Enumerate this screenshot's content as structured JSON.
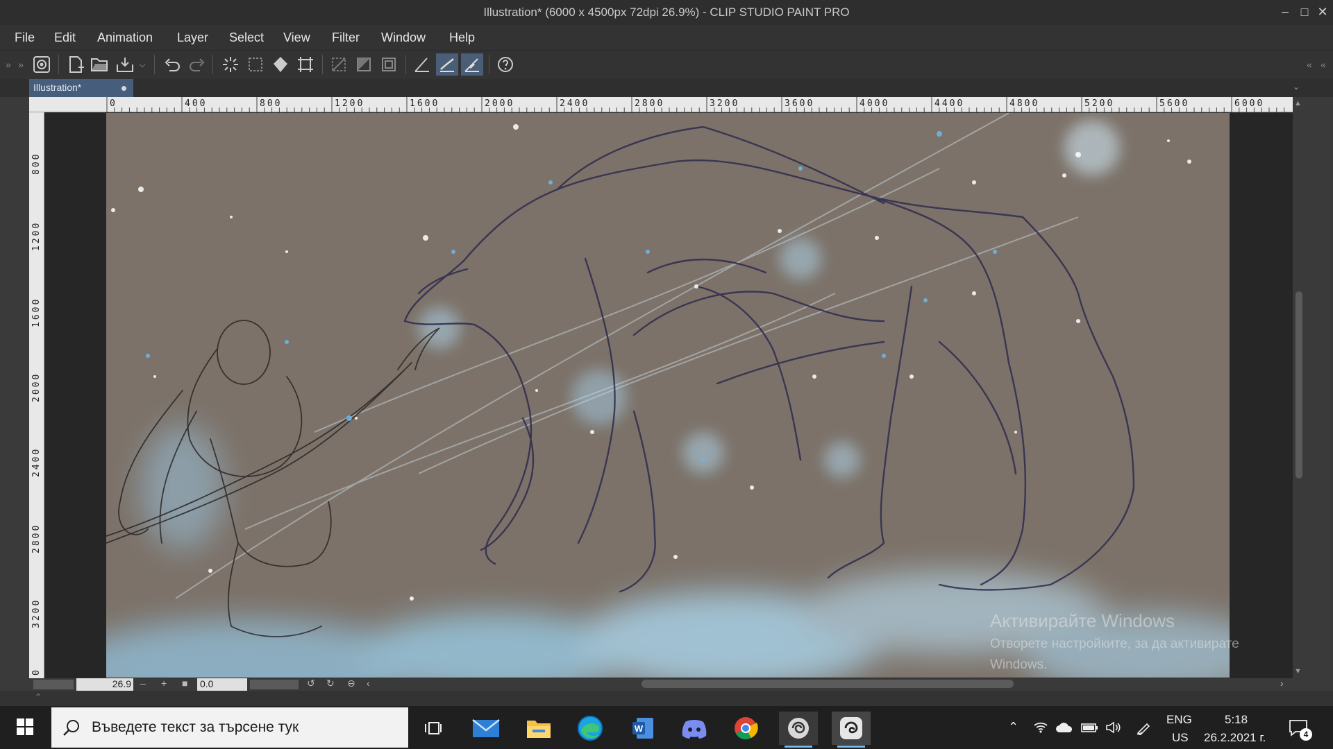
{
  "window": {
    "title": "Illustration* (6000 x 4500px 72dpi 26.9%)  - CLIP STUDIO PAINT PRO"
  },
  "menu": [
    "File",
    "Edit",
    "Animation",
    "Layer",
    "Select",
    "View",
    "Filter",
    "Window",
    "Help"
  ],
  "toolbar": {
    "icons": [
      "clip-studio-logo-icon",
      "new-file-icon",
      "open-file-icon",
      "export-icon",
      "undo-icon",
      "redo-icon",
      "clear-selection-icon",
      "deselect-icon",
      "fill-icon",
      "transform-icon",
      "hide-selection-icon",
      "invert-selection-icon",
      "selection-layer-icon",
      "stroke-correction-icon",
      "snap-ruler-icon",
      "snap-special-ruler-icon",
      "help-icon"
    ]
  },
  "tab": {
    "label": "Illustration*"
  },
  "ruler": {
    "horizontal": [
      "0",
      "400",
      "800",
      "1200",
      "1600",
      "2000",
      "2400",
      "2800",
      "3200",
      "3600",
      "4000",
      "4400",
      "4800",
      "5200",
      "5600",
      "6000"
    ],
    "vertical": [
      "800",
      "1200",
      "1600",
      "2000",
      "2400",
      "2800",
      "3200",
      "0"
    ]
  },
  "status": {
    "zoom": "26.9",
    "angle": "0.0"
  },
  "watermark": {
    "line1": "Активирайте Windows",
    "line2": "Отворете настройките, за да активирате",
    "line3": "Windows."
  },
  "taskbar": {
    "search_placeholder": "Въведете текст за търсене тук",
    "lang_top": "ENG",
    "lang_bottom": "US",
    "time": "5:18",
    "date": "26.2.2021 г.",
    "notification_count": "4"
  }
}
